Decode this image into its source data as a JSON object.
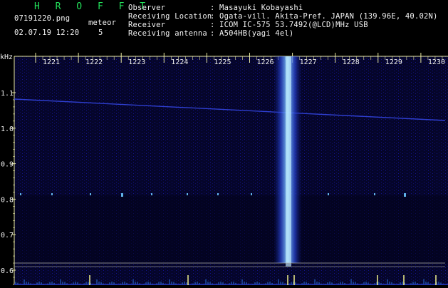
{
  "app": {
    "title": "H R O F F T"
  },
  "file": {
    "name": "07191220.png",
    "timestamp": "02.07.19 12:20"
  },
  "detection": {
    "label": "meteor",
    "count": "5"
  },
  "info": [
    {
      "label": "Observer",
      "value": ": Masayuki Kobayashi"
    },
    {
      "label": "Receiving Location",
      "value": ": Ogata-vill. Akita-Pref. JAPAN (139.96E, 40.02N)"
    },
    {
      "label": "Receiver",
      "value": ": ICOM IC-575 53.7492(@LCD)MHz USB"
    },
    {
      "label": "Receiving antenna",
      "value": ": A504HB(yagi 4el)"
    }
  ],
  "colors": {
    "header_green": "#22e05a",
    "header_white": "#f2f2f2",
    "grid_yellow": "#e8e8a0",
    "trace_blue": "#3040d0",
    "echo_cyan": "#6cc8ff"
  },
  "spectrogram": {
    "y_unit": "kHz",
    "y_ticks": [
      "1.1",
      "1.0",
      "0.9",
      "0.8",
      "0.7",
      "0.6"
    ],
    "x_ticks": [
      "1221",
      "1222",
      "1223",
      "1224",
      "1225",
      "1226",
      "1227",
      "1228",
      "1229",
      "1230"
    ]
  }
}
